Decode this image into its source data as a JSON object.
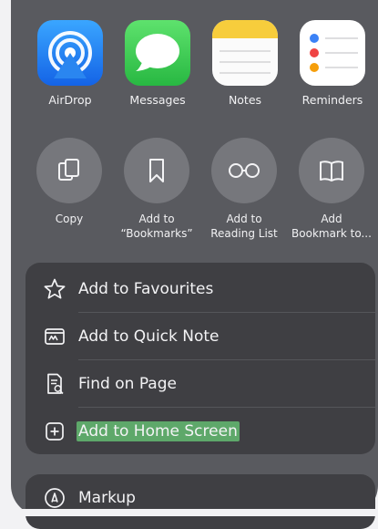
{
  "apps": [
    {
      "label": "AirDrop",
      "icon": "airdrop-icon",
      "color": "#1e8cf2"
    },
    {
      "label": "Messages",
      "icon": "messages-icon",
      "color": "#34c759"
    },
    {
      "label": "Notes",
      "icon": "notes-icon",
      "color": "#f7cd3c"
    },
    {
      "label": "Reminders",
      "icon": "reminders-icon",
      "color": "#ffffff"
    }
  ],
  "actions": [
    {
      "label": "Copy",
      "icon": "copy-icon"
    },
    {
      "label": "Add to\n“Bookmarks”",
      "icon": "bookmark-icon"
    },
    {
      "label": "Add to\nReading List",
      "icon": "reading-glasses-icon"
    },
    {
      "label": "Add\nBookmark to...",
      "icon": "book-icon"
    }
  ],
  "menu": [
    {
      "label": "Add to Favourites",
      "icon": "star-icon"
    },
    {
      "label": "Add to Quick Note",
      "icon": "quick-note-icon"
    },
    {
      "label": "Find on Page",
      "icon": "find-on-page-icon"
    },
    {
      "label": "Add to Home Screen",
      "icon": "add-square-icon",
      "highlighted": true
    }
  ],
  "markup": {
    "label": "Markup",
    "icon": "markup-icon"
  },
  "colors": {
    "sheet_bg": "#595a5f",
    "group_bg": "#3f3f43",
    "highlight": "#5ea86a"
  }
}
